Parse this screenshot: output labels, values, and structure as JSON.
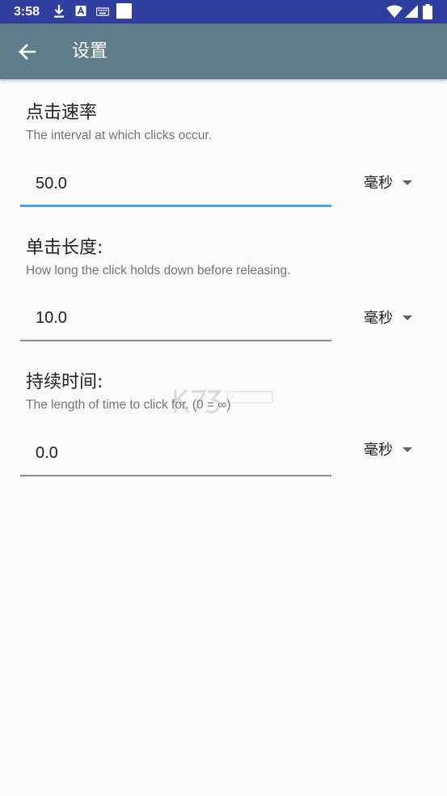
{
  "status_bar": {
    "time": "3:58",
    "icons_left": [
      "download-icon",
      "a-box-icon",
      "keyboard-icon",
      "white-square-icon"
    ],
    "icons_right": [
      "wifi-icon",
      "cell-signal-icon",
      "battery-icon"
    ],
    "background": "#303f9f"
  },
  "app_bar": {
    "title": "设置",
    "back_icon": "arrow-back-icon",
    "background": "#607d8b"
  },
  "settings": [
    {
      "title": "点击速率",
      "description": "The interval at which clicks occur.",
      "value": "50.0",
      "unit": "毫秒",
      "focused": true
    },
    {
      "title": "单击长度:",
      "description": "How long the click holds down before releasing.",
      "value": "10.0",
      "unit": "毫秒",
      "focused": false
    },
    {
      "title": "持续时间:",
      "description": "The length of time to click for. (0 = ∞)",
      "value": "0.0",
      "unit": "毫秒",
      "focused": false
    }
  ],
  "colors": {
    "accent": "#42a5f5",
    "underline": "#8c8c8c"
  }
}
